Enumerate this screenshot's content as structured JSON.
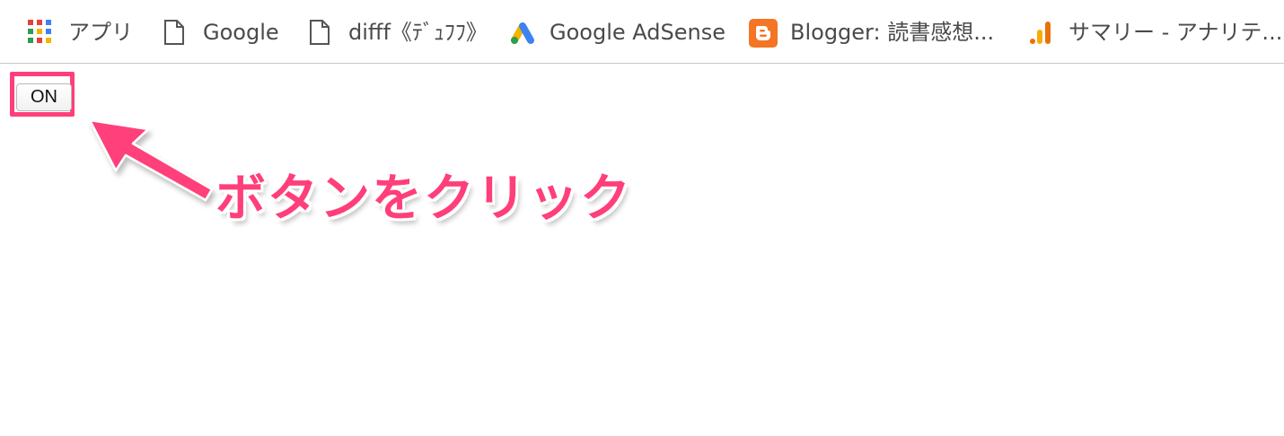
{
  "bookmarks": [
    {
      "label": "アプリ",
      "icon": "apps-grid-icon"
    },
    {
      "label": "Google",
      "icon": "page-icon"
    },
    {
      "label": "difff《ﾃﾞｭﾌﾌ》",
      "icon": "page-icon"
    },
    {
      "label": "Google AdSense",
      "icon": "adsense-icon"
    },
    {
      "label": "Blogger: 読書感想...",
      "icon": "blogger-icon"
    },
    {
      "label": "サマリー - アナリテ...",
      "icon": "analytics-icon"
    }
  ],
  "button": {
    "label": "ON"
  },
  "annotation": {
    "text": "ボタンをクリック"
  },
  "colors": {
    "accent": "#ff3f7a",
    "bookmark_text": "#4a4a4a"
  }
}
